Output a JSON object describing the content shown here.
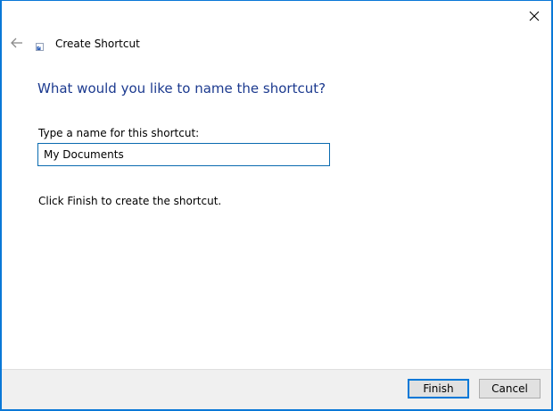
{
  "window": {
    "title": "Create Shortcut"
  },
  "page": {
    "heading": "What would you like to name the shortcut?",
    "field_label": "Type a name for this shortcut:",
    "name_value": "My Documents",
    "instruction": "Click Finish to create the shortcut."
  },
  "buttons": {
    "finish_label": "Finish",
    "cancel_label": "Cancel"
  },
  "icons": {
    "close": "close-icon",
    "back": "back-arrow-icon",
    "app": "shortcut-icon"
  },
  "colors": {
    "accent": "#0078d7",
    "heading": "#1c3a8f"
  }
}
